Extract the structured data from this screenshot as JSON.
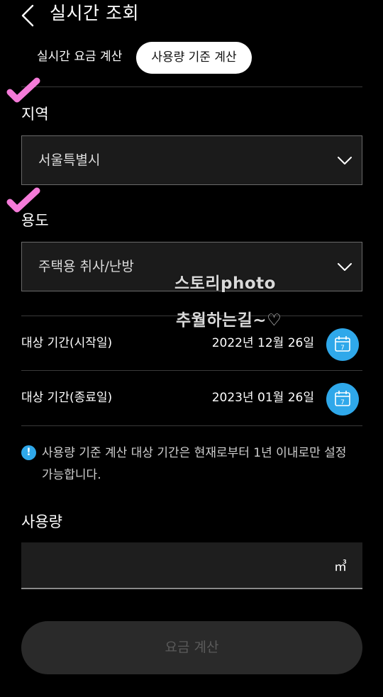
{
  "header": {
    "title": "실시간 조회",
    "back_icon": "chevron-left-icon"
  },
  "tabs": [
    {
      "label": "실시간 요금 계산",
      "active": false
    },
    {
      "label": "사용량 기준 계산",
      "active": true
    }
  ],
  "form": {
    "region": {
      "label": "지역",
      "value": "서울특별시"
    },
    "usage_type": {
      "label": "용도",
      "value": "주택용 취사/난방"
    },
    "start_date": {
      "label": "대상 기간(시작일)",
      "value": "2022년 12월 26일",
      "icon_day": "7"
    },
    "end_date": {
      "label": "대상 기간(종료일)",
      "value": "2023년 01월 26일",
      "icon_day": "7"
    },
    "notice": "사용량 기준 계산 대상 기간은 현재로부터 1년 이내로만 설정 가능합니다.",
    "usage": {
      "label": "사용량",
      "value": "",
      "unit": "㎥"
    },
    "submit_label": "요금 계산"
  },
  "watermark": {
    "line1": "스토리photo",
    "line2": "추월하는길~♡"
  },
  "colors": {
    "accent": "#2fa8ea",
    "check_mark": "#f57bd9",
    "background": "#000000"
  }
}
